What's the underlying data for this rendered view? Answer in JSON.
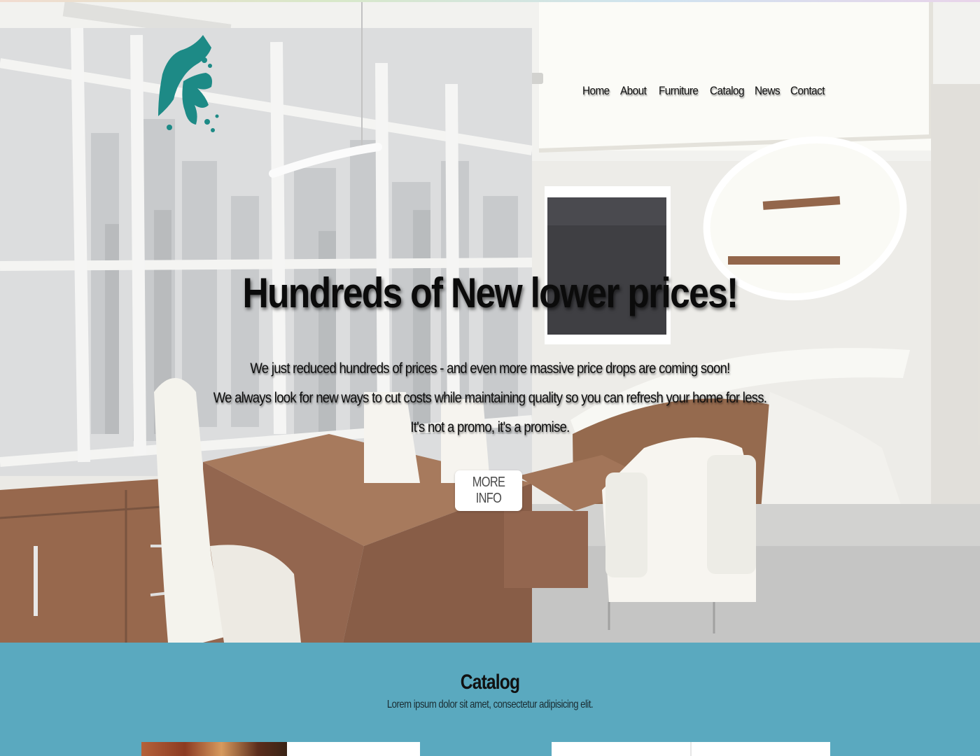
{
  "nav": {
    "items": [
      {
        "label": "Home"
      },
      {
        "label": "About"
      },
      {
        "label": "Furniture"
      },
      {
        "label": "Catalog"
      },
      {
        "label": "News"
      },
      {
        "label": "Contact"
      }
    ]
  },
  "hero": {
    "title": "Hundreds of New lower prices!",
    "lines": [
      "We just reduced hundreds of prices - and even more massive price drops are coming soon!",
      "We always look for new ways to cut costs while maintaining quality so you can refresh your home for less.",
      "It's not a promo, it's a promise."
    ],
    "button_label": "MORE INFO"
  },
  "catalog": {
    "title": "Catalog",
    "subtitle": "Lorem ipsum dolor sit amet, consectetur adipisicing elit."
  },
  "colors": {
    "logo": "#1d8a86",
    "catalog_bg": "#5aa9bf",
    "button_bg": "#ffffff"
  }
}
